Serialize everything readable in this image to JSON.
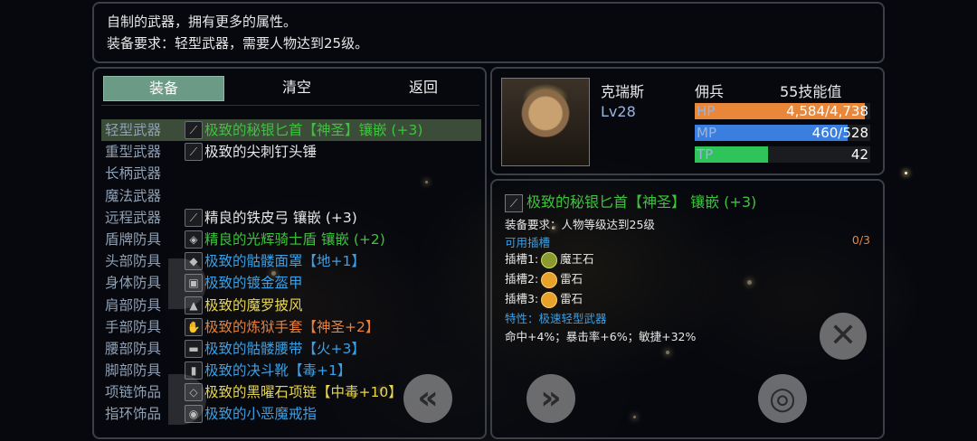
{
  "description": {
    "line1": "自制的武器，拥有更多的属性。",
    "line2": "装备要求：轻型武器，需要人物达到25级。"
  },
  "tabs": [
    "装备",
    "清空",
    "返回"
  ],
  "equipment": [
    {
      "slot": "轻型武器",
      "item": "极致的秘银匕首【神圣】镶嵌 (+3)",
      "color": "green",
      "selected": true
    },
    {
      "slot": "重型武器",
      "item": "极致的尖刺钉头锤",
      "color": "white"
    },
    {
      "slot": "长柄武器",
      "item": "",
      "color": "white"
    },
    {
      "slot": "魔法武器",
      "item": "",
      "color": "white"
    },
    {
      "slot": "远程武器",
      "item": "精良的铁皮弓 镶嵌 (+3)",
      "color": "white"
    },
    {
      "slot": "盾牌防具",
      "item": "精良的光辉骑士盾 镶嵌 (+2)",
      "color": "green"
    },
    {
      "slot": "头部防具",
      "item": "极致的骷髅面罩【地+1】",
      "color": "blue"
    },
    {
      "slot": "身体防具",
      "item": "极致的镀金盔甲",
      "color": "blue"
    },
    {
      "slot": "肩部防具",
      "item": "极致的魔罗披风",
      "color": "yellow"
    },
    {
      "slot": "手部防具",
      "item": "极致的炼狱手套【神圣+2】",
      "color": "orange"
    },
    {
      "slot": "腰部防具",
      "item": "极致的骷髅腰带【火+3】",
      "color": "blue"
    },
    {
      "slot": "脚部防具",
      "item": "极致的决斗靴【毒+1】",
      "color": "blue"
    },
    {
      "slot": "项链饰品",
      "item": "极致的黑曜石项链【中毒+10】",
      "color": "yellow"
    },
    {
      "slot": "指环饰品",
      "item": "极致的小恶魔戒指",
      "color": "blue"
    }
  ],
  "character": {
    "name": "克瑞斯",
    "level": "Lv28",
    "class": "佣兵",
    "skill_points": "55技能值",
    "hp_label": "HP",
    "hp_value": "4,584/4,738",
    "hp_ratio": 0.967,
    "mp_label": "MP",
    "mp_value": "460/528",
    "mp_ratio": 0.871,
    "tp_label": "TP",
    "tp_value": "42",
    "tp_ratio": 0.42
  },
  "detail": {
    "title": "极致的秘银匕首【神圣】 镶嵌 (+3)",
    "requirement": "装备要求：人物等级达到25级",
    "sockets_label": "可用插槽",
    "sockets_used": "0/3",
    "socket1_label": "插槽1:",
    "socket1_gem": "魔王石",
    "socket2_label": "插槽2:",
    "socket2_gem": "雷石",
    "socket3_label": "插槽3:",
    "socket3_gem": "雷石",
    "trait": "特性：极速轻型武器",
    "stats": "命中+4%；暴击率+6%；敏捷+32%"
  },
  "colors": {
    "green": "#3bc43b",
    "blue": "#3aa0e6",
    "yellow": "#e8d64a",
    "orange": "#e8803a",
    "white": "#e6e6e6",
    "hp_bar": "#e8863a",
    "mp_bar": "#3a7fe0",
    "tp_bar": "#2ec45a"
  }
}
